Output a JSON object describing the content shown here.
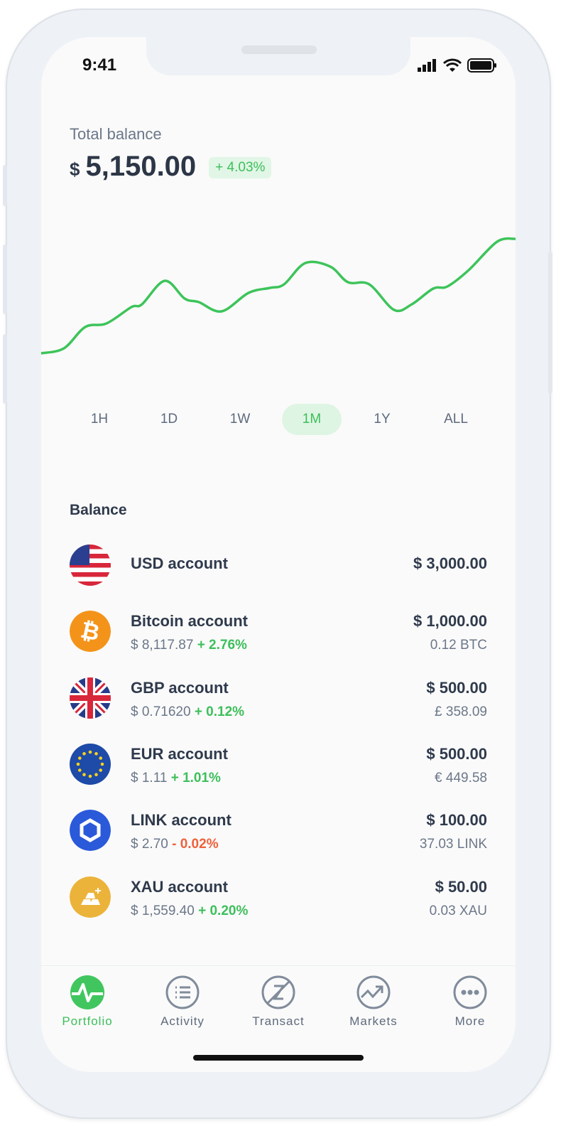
{
  "status": {
    "time": "9:41",
    "icons": [
      "signal-icon",
      "wifi-icon",
      "battery-icon"
    ]
  },
  "header": {
    "label": "Total balance",
    "currency": "$",
    "amount": "5,150.00",
    "change": "+ 4.03%"
  },
  "colors": {
    "accent": "#3dbf5b",
    "negative": "#f0603a",
    "text": "#2f3a4c",
    "muted": "#6b7789"
  },
  "ranges": [
    {
      "label": "1H"
    },
    {
      "label": "1D"
    },
    {
      "label": "1W"
    },
    {
      "label": "1M",
      "selected": true
    },
    {
      "label": "1Y"
    },
    {
      "label": "ALL"
    }
  ],
  "balance": {
    "title": "Balance",
    "accounts": [
      {
        "icon": "us-flag-icon",
        "name": "USD account",
        "price": "",
        "change": "",
        "value": "$ 3,000.00",
        "holding": ""
      },
      {
        "icon": "bitcoin-icon",
        "name": "Bitcoin account",
        "price": "$ 8,117.87",
        "change": "+ 2.76%",
        "value": "$ 1,000.00",
        "holding": "0.12 BTC"
      },
      {
        "icon": "uk-flag-icon",
        "name": "GBP account",
        "price": "$ 0.71620",
        "change": "+ 0.12%",
        "value": "$ 500.00",
        "holding": "£ 358.09"
      },
      {
        "icon": "eu-flag-icon",
        "name": "EUR account",
        "price": "$ 1.11",
        "change": "+ 1.01%",
        "value": "$ 500.00",
        "holding": "€ 449.58"
      },
      {
        "icon": "chainlink-icon",
        "name": "LINK account",
        "price": "$ 2.70",
        "change": "- 0.02%",
        "value": "$ 100.00",
        "holding": "37.03 LINK"
      },
      {
        "icon": "gold-icon",
        "name": "XAU account",
        "price": "$ 1,559.40",
        "change": "+ 0.20%",
        "value": "$ 50.00",
        "holding": "0.03 XAU"
      }
    ]
  },
  "tabs": [
    {
      "label": "Portfolio",
      "icon": "pulse-icon",
      "selected": true
    },
    {
      "label": "Activity",
      "icon": "list-icon"
    },
    {
      "label": "Transact",
      "icon": "transact-icon"
    },
    {
      "label": "Markets",
      "icon": "trend-icon"
    },
    {
      "label": "More",
      "icon": "more-icon"
    }
  ]
}
